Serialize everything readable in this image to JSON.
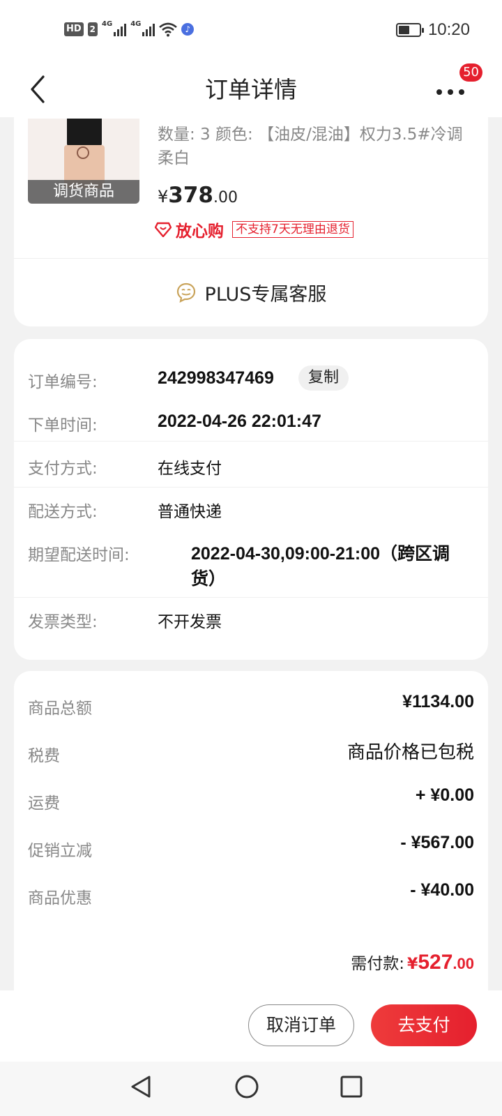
{
  "status_bar": {
    "hd": "HD",
    "sim": "2",
    "net1": "4G",
    "net2": "4G",
    "battery_level": 0.55,
    "time": "10:20"
  },
  "nav": {
    "title": "订单详情",
    "badge": "50"
  },
  "product": {
    "thumb_tag": "调货商品",
    "attributes": "数量: 3   颜色: 【油皮/混油】权力3.5#冷调柔白",
    "price_currency": "¥",
    "price_int": "378",
    "price_dec": ".00",
    "guarantee_label": "放心购",
    "return_policy": "不支持7天无理由退货",
    "service_label": "PLUS专属客服"
  },
  "order_info": {
    "order_no_label": "订单编号:",
    "order_no": "242998347469",
    "copy_label": "复制",
    "order_time_label": "下单时间:",
    "order_time": "2022-04-26 22:01:47",
    "payment_label": "支付方式:",
    "payment": "在线支付",
    "shipping_label": "配送方式:",
    "shipping": "普通快递",
    "expected_label": "期望配送时间:",
    "expected_line1": "2022-04-30,09:00-21:00（跨区调",
    "expected_line2": "货）",
    "invoice_label": "发票类型:",
    "invoice": "不开发票"
  },
  "amounts": {
    "goods_total_label": "商品总额",
    "goods_total": "¥1134.00",
    "tax_label": "税费",
    "tax": "商品价格已包税",
    "freight_label": "运费",
    "freight": "+ ¥0.00",
    "promo_label": "促销立减",
    "promo": "- ¥567.00",
    "coupon_label": "商品优惠",
    "coupon": "- ¥40.00",
    "payable_label": "需付款:",
    "payable_currency": "¥",
    "payable_int": "527",
    "payable_dec": ".00"
  },
  "actions": {
    "cancel_label": "取消订单",
    "pay_label": "去支付"
  },
  "colors": {
    "accent": "#e5202e",
    "background": "#f2f2f2",
    "card": "#ffffff",
    "muted_text": "#888888"
  }
}
